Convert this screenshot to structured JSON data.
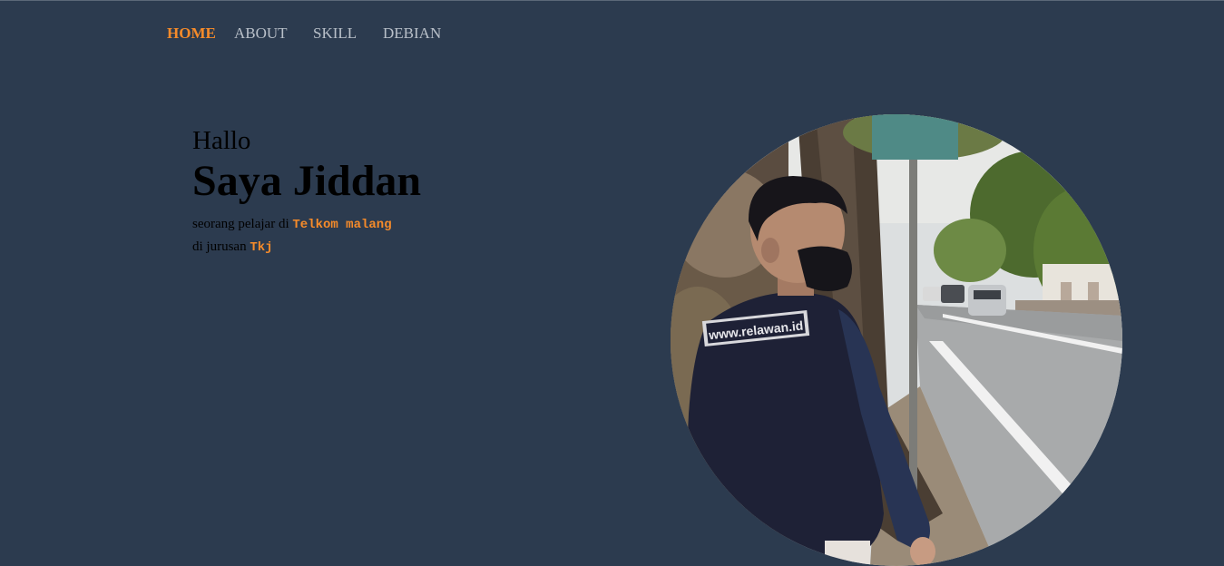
{
  "nav": {
    "items": [
      {
        "label": "HOME",
        "active": true
      },
      {
        "label": "ABOUT",
        "active": false
      },
      {
        "label": "SKILL",
        "active": false
      },
      {
        "label": "DEBIAN",
        "active": false
      }
    ]
  },
  "hero": {
    "greeting": "Hallo",
    "name": "Saya Jiddan",
    "line1_prefix": "seorang pelajar di",
    "line1_highlight": "Telkom malang",
    "line2_prefix": "di jurusan",
    "line2_highlight": "Tkj"
  },
  "photo": {
    "vest_text": "www.relawan.id"
  },
  "colors": {
    "background": "#2c3b4f",
    "accent": "#f68b2a",
    "nav_text": "#b9c0c9"
  }
}
